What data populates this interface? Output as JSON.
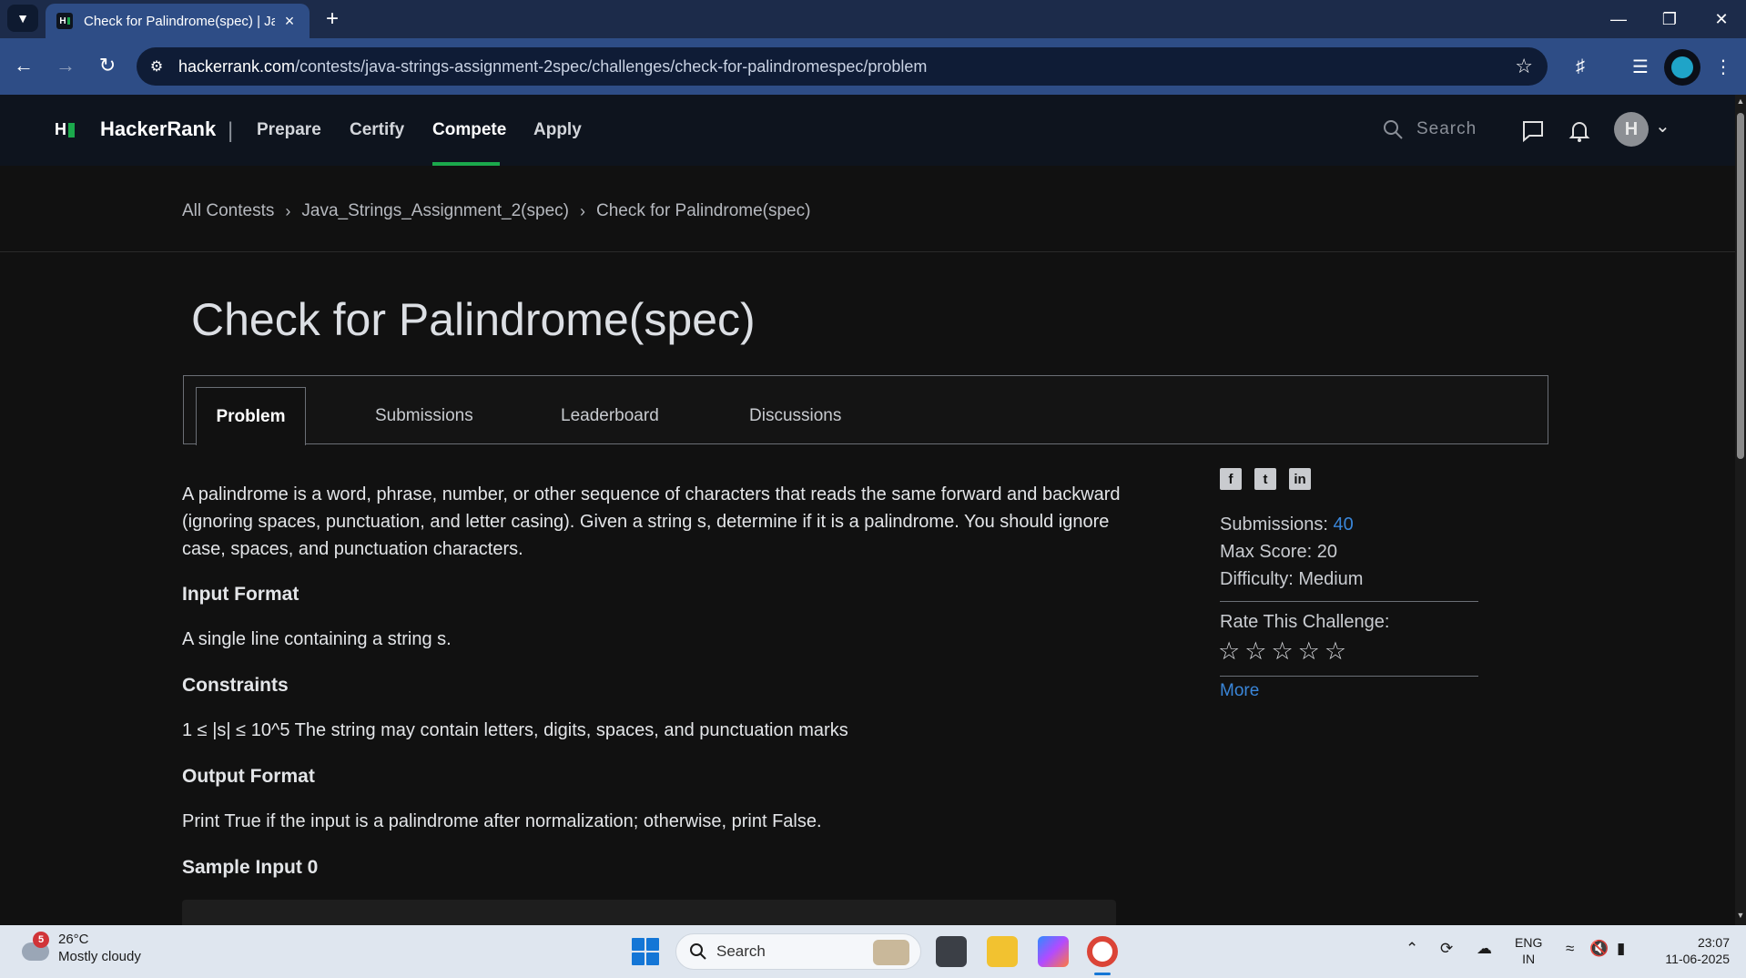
{
  "browser": {
    "tab_title": "Check for Palindrome(spec) | Ja",
    "url_domain": "hackerrank.com",
    "url_path": "/contests/java-strings-assignment-2spec/challenges/check-for-palindromespec/problem"
  },
  "nav": {
    "logo": "HackerRank",
    "separator": "|",
    "links": [
      "Prepare",
      "Certify",
      "Compete",
      "Apply"
    ],
    "active": "Compete",
    "search_placeholder": "Search",
    "avatar_initial": "H"
  },
  "breadcrumb": [
    "All Contests",
    "Java_Strings_Assignment_2(spec)",
    "Check for Palindrome(spec)"
  ],
  "challenge": {
    "title": "Check for Palindrome(spec)",
    "tabs": [
      "Problem",
      "Submissions",
      "Leaderboard",
      "Discussions"
    ],
    "active_tab": "Problem",
    "description": "A palindrome is a word, phrase, number, or other sequence of characters that reads the same forward and backward (ignoring spaces, punctuation, and letter casing). Given a string s, determine if it is a palindrome. You should ignore case, spaces, and punctuation characters.",
    "input_format_heading": "Input Format",
    "input_format": "A single line containing a string s.",
    "constraints_heading": "Constraints",
    "constraints": "1 ≤ |s| ≤ 10^5 The string may contain letters, digits, spaces, and punctuation marks",
    "output_format_heading": "Output Format",
    "output_format": "Print True if the input is a palindrome after normalization; otherwise, print False.",
    "sample_input_heading": "Sample Input 0"
  },
  "sidebar": {
    "submissions_label": "Submissions:",
    "submissions_value": "40",
    "max_score_label": "Max Score:",
    "max_score_value": "20",
    "difficulty_label": "Difficulty:",
    "difficulty_value": "Medium",
    "rate_label": "Rate This Challenge:",
    "rating": 0,
    "rating_max": 5,
    "more_label": "More"
  },
  "taskbar": {
    "weather_temp": "26°C",
    "weather_desc": "Mostly cloudy",
    "weather_badge": "5",
    "search_label": "Search",
    "lang_line1": "ENG",
    "lang_line2": "IN",
    "time": "23:07",
    "date": "11-06-2025"
  },
  "colors": {
    "accent_green": "#1ba94c",
    "link_blue": "#3a86d9",
    "nav_bg": "#0e141e",
    "page_bg": "#111111"
  }
}
